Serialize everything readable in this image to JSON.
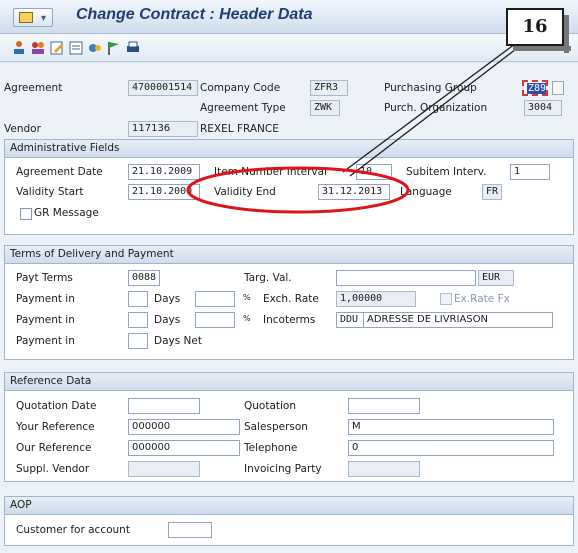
{
  "window": {
    "title": "Change Contract : Header Data"
  },
  "callout": {
    "number": "16"
  },
  "toolbar": {
    "icons": [
      "org-structure-icon",
      "partners-icon",
      "edit-icon",
      "texts-icon",
      "conditions-icon",
      "flag-icon",
      "print-icon"
    ]
  },
  "header": {
    "agreement_label": "Agreement",
    "agreement_value": "4700001514",
    "company_code_label": "Company Code",
    "company_code_value": "ZFR3",
    "purch_group_label": "Purchasing Group",
    "purch_group_value": "Z89",
    "agreement_type_label": "Agreement Type",
    "agreement_type_value": "ZWK",
    "purch_org_label": "Purch. Organization",
    "purch_org_value": "3004",
    "vendor_label": "Vendor",
    "vendor_value": "117136",
    "vendor_name": "REXEL FRANCE"
  },
  "admin": {
    "title": "Administrative Fields",
    "agreement_date_label": "Agreement Date",
    "agreement_date_value": "21.10.2009",
    "item_interval_label": "Item Number Interval",
    "item_interval_value": "10",
    "subitem_label": "Subitem Interv.",
    "subitem_value": "1",
    "validity_start_label": "Validity Start",
    "validity_start_value": "21.10.2009",
    "validity_end_label": "Validity End",
    "validity_end_value": "31.12.2013",
    "language_label": "Language",
    "language_value": "FR",
    "gr_message_label": "GR Message"
  },
  "terms": {
    "title": "Terms of Delivery and Payment",
    "payt_terms_label": "Payt Terms",
    "payt_terms_value": "0088",
    "targ_val_label": "Targ. Val.",
    "targ_val_value": "",
    "currency_value": "EUR",
    "payment_in_label": "Payment in",
    "days_label": "Days",
    "percent_symbol": "%",
    "exch_rate_label": "Exch. Rate",
    "exch_rate_value": "1,00000",
    "ex_rate_fx_label": "Ex.Rate Fx",
    "incoterms_label": "Incoterms",
    "incoterms_code": "DDU",
    "incoterms_text": "ADRESSE DE LIVRIASON",
    "days_net_label": "Days Net"
  },
  "reference": {
    "title": "Reference Data",
    "quotation_date_label": "Quotation Date",
    "quotation_label": "Quotation",
    "your_ref_label": "Your Reference",
    "your_ref_value": "000000",
    "salesperson_label": "Salesperson",
    "salesperson_value": "M",
    "our_ref_label": "Our Reference",
    "our_ref_value": "000000",
    "telephone_label": "Telephone",
    "telephone_value": "0",
    "suppl_vendor_label": "Suppl. Vendor",
    "invoicing_party_label": "Invoicing Party"
  },
  "aop": {
    "title": "AOP",
    "customer_label": "Customer for account"
  },
  "colors": {
    "highlight_ellipse": "#e0131a",
    "callout_line": "#1c1c1c"
  }
}
